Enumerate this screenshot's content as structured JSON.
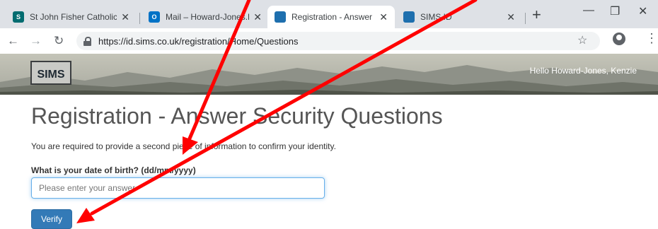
{
  "browser": {
    "tabs": [
      {
        "title": "St John Fisher Catholic H",
        "favicon_color": "#036c70",
        "favicon_glyph": "S"
      },
      {
        "title": "Mail – Howard-Jones.K@",
        "favicon_color": "#0072c6",
        "favicon_glyph": "O"
      },
      {
        "title": "Registration - Answer Sec",
        "favicon_color": "#1e6fae",
        "favicon_glyph": "",
        "active": true
      },
      {
        "title": "SIMS ID",
        "favicon_color": "#1e6fae",
        "favicon_glyph": ""
      }
    ],
    "url": "https://id.sims.co.uk/registration/Home/Questions"
  },
  "header": {
    "logo_text": "SIMS",
    "greeting": "Hello Howard-Jones, Kenzie"
  },
  "main": {
    "title": "Registration - Answer Security Questions",
    "description": "You are required to provide a second piece of information to confirm your identity.",
    "question_label": "What is your date of birth? (dd/mm/yyyy)",
    "answer_placeholder": "Please enter your answer",
    "answer_value": "",
    "verify_label": "Verify"
  },
  "colors": {
    "primary_button": "#337ab7",
    "annotation_arrow": "#ff0000"
  }
}
